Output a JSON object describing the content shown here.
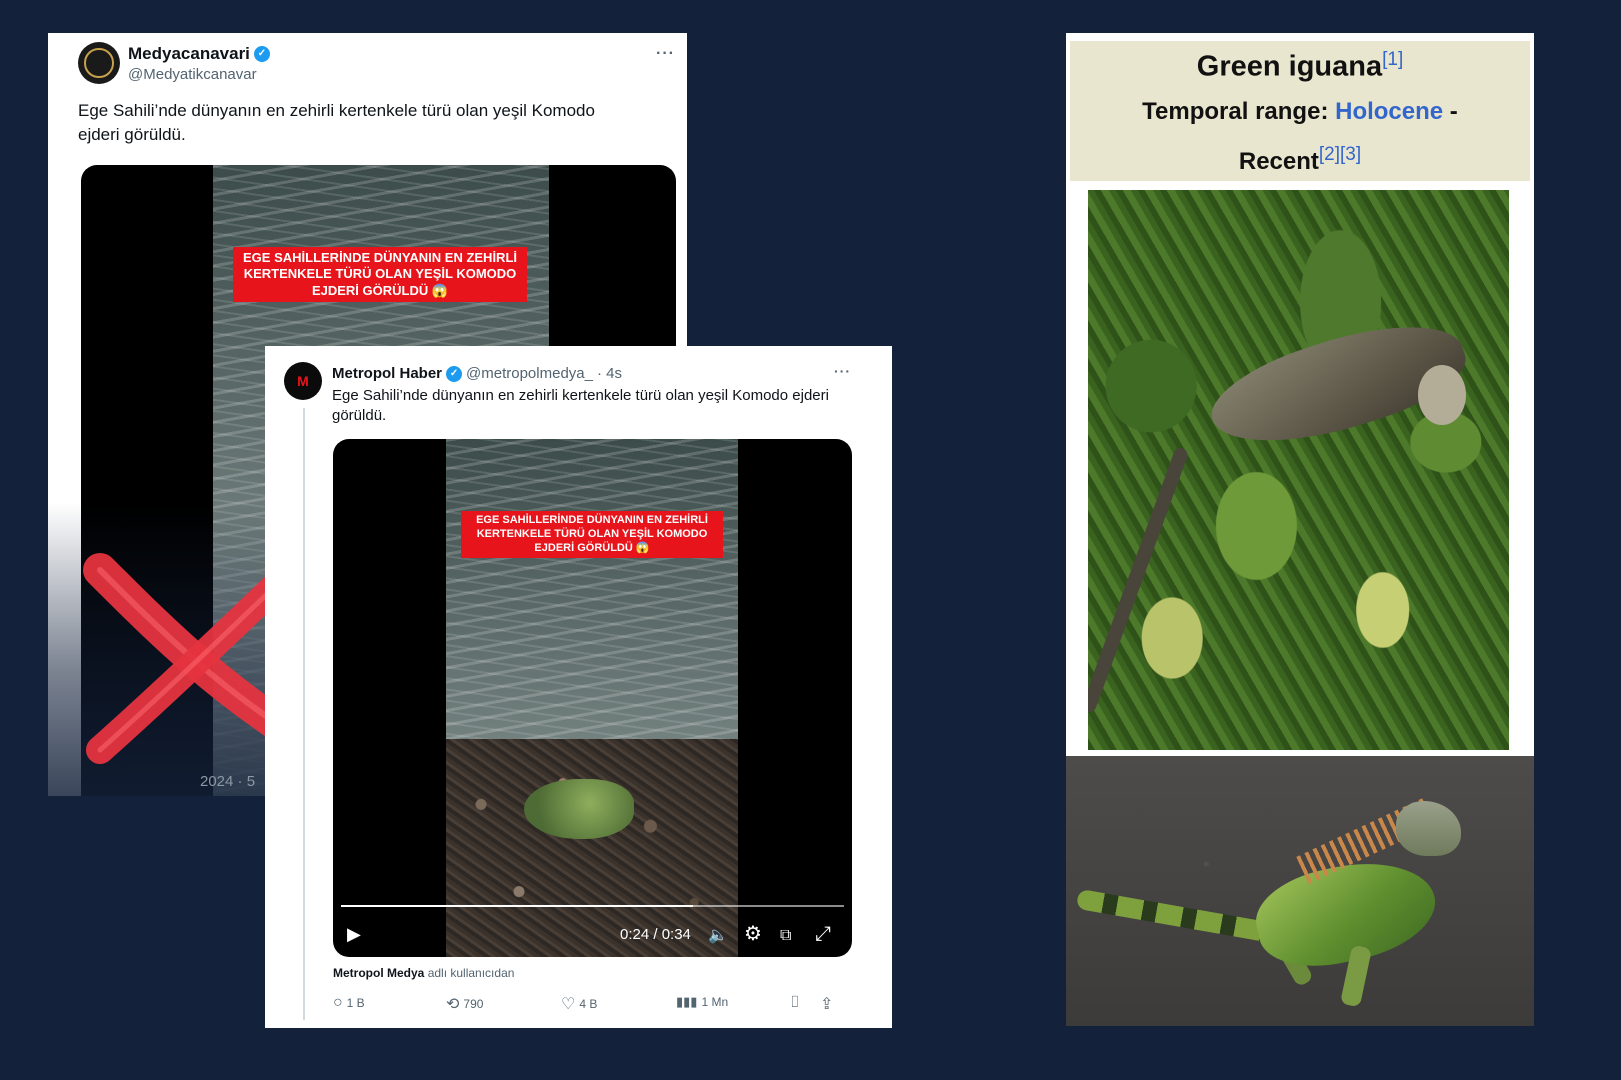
{
  "tweet_back": {
    "display_name": "Medyacanavari",
    "handle": "@Medyatikcanavar",
    "more": "···",
    "text": "Ege Sahili’nde dünyanın en zehirli kertenkele türü olan yeşil Komodo ejderi görüldü.",
    "video_banner": "EGE SAHİLLERİNDE DÜNYANIN EN ZEHİRLİ KERTENKELE TÜRÜ OLAN YEŞİL KOMODO EJDERİ GÖRÜLDÜ 😱",
    "date_partial": "2024 · 5"
  },
  "tweet_front": {
    "display_name": "Metropol Haber",
    "handle": "@metropolmedya_",
    "time_ago": "· 4s",
    "more": "···",
    "text": "Ege Sahili’nde dünyanın en zehirli kertenkele türü olan yeşil Komodo ejderi görüldü.",
    "video_banner": "EGE SAHİLLERİNDE DÜNYANIN EN ZEHİRLİ KERTENKELE TÜRÜ OLAN YEŞİL KOMODO EJDERİ GÖRÜLDÜ 😱",
    "video_time": "0:24 / 0:34",
    "video_progress": 0.7,
    "caption_user": "Metropol Medya",
    "caption_suffix": "adlı kullanıcıdan",
    "replies": "1 B",
    "retweets": "790",
    "likes": "4 B",
    "views": "1 Mn"
  },
  "wiki": {
    "title": "Green iguana",
    "title_ref": "[1]",
    "range_label": "Temporal range:",
    "range_link": "Holocene",
    "range_dash": " -",
    "recent": "Recent",
    "recent_refs": "[2][3]"
  },
  "icons": {
    "verified": "✓",
    "play": "▶",
    "volume": "🔈",
    "settings": "⚙",
    "fullscreen": "⤢",
    "reply": "💬",
    "retweet": "⟲",
    "like": "♡",
    "views": "📊",
    "bookmark": "🔖",
    "share": "⇪"
  },
  "colors": {
    "background": "#13213a",
    "banner_red": "#e8141b",
    "verified_blue": "#1d9bf0",
    "wiki_link": "#3366cc",
    "wiki_header": "#e9e6cf",
    "cross_red": "#e5343f"
  }
}
